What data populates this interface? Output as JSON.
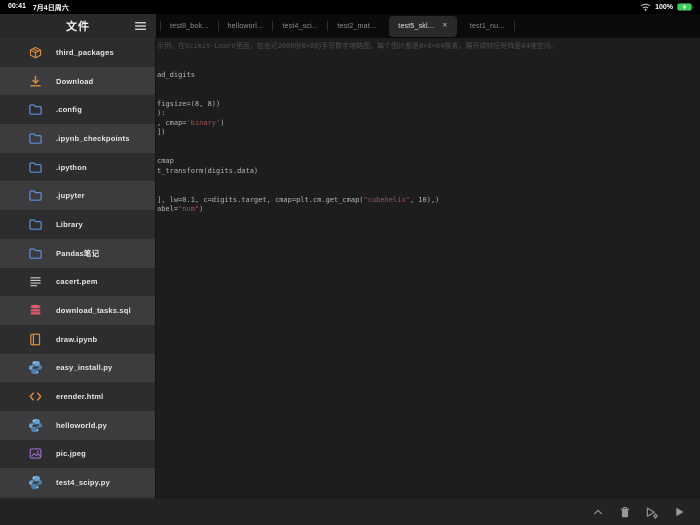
{
  "status_bar": {
    "time": "00:41",
    "date": "7月4日周六",
    "battery": "100%"
  },
  "sidebar": {
    "title": "文件",
    "items": [
      {
        "label": "third_packages",
        "icon": "package"
      },
      {
        "label": "Download",
        "icon": "download"
      },
      {
        "label": ".config",
        "icon": "folder"
      },
      {
        "label": ".ipynb_checkpoints",
        "icon": "folder"
      },
      {
        "label": ".ipython",
        "icon": "folder"
      },
      {
        "label": ".jupyter",
        "icon": "folder"
      },
      {
        "label": "Library",
        "icon": "folder"
      },
      {
        "label": "Pandas笔记",
        "icon": "folder"
      },
      {
        "label": "cacert.pem",
        "icon": "text-lines"
      },
      {
        "label": "download_tasks.sql",
        "icon": "database"
      },
      {
        "label": "draw.ipynb",
        "icon": "notebook"
      },
      {
        "label": "easy_install.py",
        "icon": "python"
      },
      {
        "label": "erender.html",
        "icon": "html"
      },
      {
        "label": "helloworld.py",
        "icon": "python"
      },
      {
        "label": "pic.jpeg",
        "icon": "image"
      },
      {
        "label": "test4_scipy.py",
        "icon": "python"
      }
    ]
  },
  "tab_bar": {
    "tabs": [
      {
        "label": "test8_bok..."
      },
      {
        "label": "helloworl..."
      },
      {
        "label": "test4_sci..."
      },
      {
        "label": "test2_mat..."
      },
      {
        "label": "test5_skl...",
        "active": true,
        "close_label": "✕"
      },
      {
        "label": "test1_nu..."
      }
    ]
  },
  "editor": {
    "code_lines": [
      {
        "segs": [
          {
            "t": "示例，在Scikit-Learn里面，包含近2000份8×8的手写数字缩略图，每个图片都是8×8=64像素，展开成特征矩阵是64维空间。",
            "c": "comment"
          }
        ]
      },
      {
        "segs": []
      },
      {
        "segs": []
      },
      {
        "segs": [
          {
            "t": "ad_digits",
            "c": "code"
          }
        ]
      },
      {
        "segs": []
      },
      {
        "segs": []
      },
      {
        "segs": [
          {
            "t": "figsize=(8, 8))",
            "c": "code"
          }
        ]
      },
      {
        "segs": [
          {
            "t": "):",
            "c": "code"
          }
        ]
      },
      {
        "segs": [
          {
            "t": ", cmap=",
            "c": "code"
          },
          {
            "t": "'binary'",
            "c": "string"
          },
          {
            "t": ")",
            "c": "code"
          }
        ]
      },
      {
        "segs": [
          {
            "t": "])",
            "c": "code"
          }
        ]
      },
      {
        "segs": []
      },
      {
        "segs": []
      },
      {
        "segs": [
          {
            "t": "cmap",
            "c": "code"
          }
        ]
      },
      {
        "segs": [
          {
            "t": "t_transform(digits.data)",
            "c": "code"
          }
        ]
      },
      {
        "segs": []
      },
      {
        "segs": []
      },
      {
        "segs": [
          {
            "t": "], lw=0.1, c=digits.target, cmap=plt.cm.get_cmap(",
            "c": "code"
          },
          {
            "t": "\"cubehelix\"",
            "c": "string"
          },
          {
            "t": ", 10),)",
            "c": "code"
          }
        ]
      },
      {
        "segs": [
          {
            "t": "abel=",
            "c": "code"
          },
          {
            "t": "\"num\"",
            "c": "string"
          },
          {
            "t": ")",
            "c": "code"
          }
        ]
      }
    ]
  },
  "colors": {
    "accent_orange": "#d98f3f",
    "folder_blue": "#5b8fd6",
    "python_blue": "#6ba1d3",
    "python_dark": "#4d7fad",
    "sql_red": "#e25b6d",
    "image_purple": "#9a6fc9",
    "file_gray": "#c9c9c9",
    "string_red": "#9e5656",
    "battery_green": "#32d158",
    "tab_active_bg": "#29292b",
    "icon_gray": "#969696"
  }
}
